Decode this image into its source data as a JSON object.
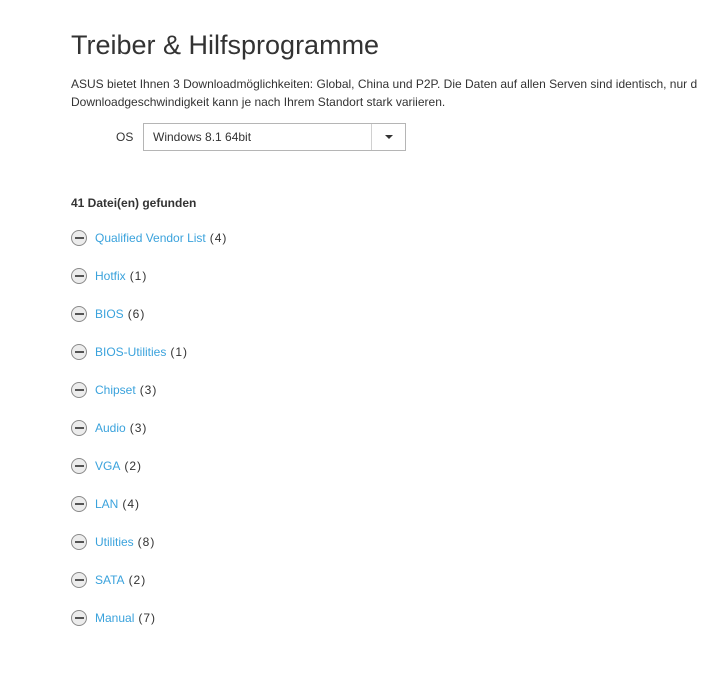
{
  "page": {
    "title": "Treiber & Hilfsprogramme",
    "intro_line1": "ASUS bietet Ihnen 3 Downloadmöglichkeiten: Global, China und P2P. Die Daten auf allen Serven sind identisch, nur d",
    "intro_line2": "Downloadgeschwindigkeit kann je nach Ihrem Standort stark variieren."
  },
  "os_selector": {
    "label": "OS",
    "selected": "Windows 8.1 64bit"
  },
  "results": {
    "found_text": "41 Datei(en) gefunden"
  },
  "categories": [
    {
      "name": "Qualified Vendor List",
      "count": "(4)"
    },
    {
      "name": "Hotfix",
      "count": "(1)"
    },
    {
      "name": "BIOS",
      "count": "(6)"
    },
    {
      "name": "BIOS-Utilities",
      "count": "(1)"
    },
    {
      "name": "Chipset",
      "count": "(3)"
    },
    {
      "name": "Audio",
      "count": "(3)"
    },
    {
      "name": "VGA",
      "count": "(2)"
    },
    {
      "name": "LAN",
      "count": "(4)"
    },
    {
      "name": "Utilities",
      "count": "(8)"
    },
    {
      "name": "SATA",
      "count": "(2)"
    },
    {
      "name": "Manual",
      "count": "(7)"
    }
  ],
  "colors": {
    "link": "#3aa2dc",
    "text": "#333333"
  }
}
